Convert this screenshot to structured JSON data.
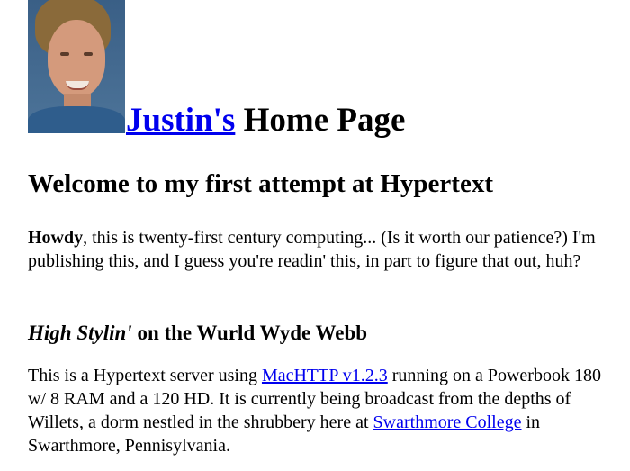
{
  "header": {
    "portrait_alt": "Photo of Justin",
    "title_link": "Justin's",
    "title_rest": " Home Page"
  },
  "welcome": {
    "heading": "Welcome to my first attempt at Hypertext"
  },
  "intro": {
    "bold": "Howdy",
    "text": ", this is twenty-first century computing... (Is it worth our patience?) I'm publishing this, and I guess you're readin' this, in part to figure that out, huh?"
  },
  "styling": {
    "italic": "High Stylin'",
    "rest": " on the Wurld Wyde Webb"
  },
  "server": {
    "text1": "This is a Hypertext server using ",
    "link1": "MacHTTP v1.2.3",
    "text2": " running on a Powerbook 180 w/ 8 RAM and a 120 HD. It is currently being broadcast from the depths of Willets, a dorm nestled in the shrubbery here at ",
    "link2": "Swarthmore College",
    "text3": " in Swarthmore, Pennisylvania."
  }
}
